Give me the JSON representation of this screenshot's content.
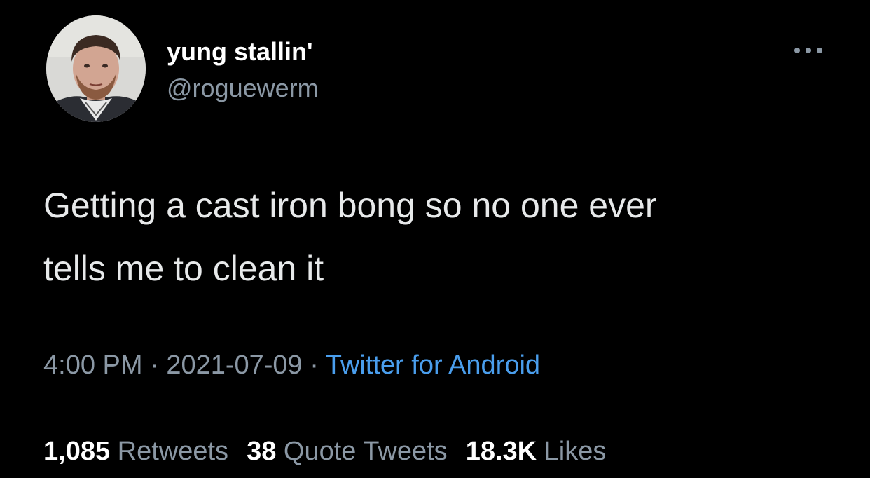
{
  "user": {
    "display_name": "yung stallin'",
    "handle": "@roguewerm"
  },
  "tweet": {
    "text": "Getting a cast iron bong so no one ever\ntells me to clean it",
    "time": "4:00 PM",
    "date": "2021-07-09",
    "separator": "·",
    "source": "Twitter for Android"
  },
  "stats": {
    "retweets": {
      "count": "1,085",
      "label": "Retweets"
    },
    "quotes": {
      "count": "38",
      "label": "Quote Tweets"
    },
    "likes": {
      "count": "18.3K",
      "label": "Likes"
    }
  },
  "icons": {
    "more": "more-horizontal-icon"
  },
  "colors": {
    "background": "#000000",
    "primary_text": "#e7e9ea",
    "secondary_text": "#8b98a5",
    "link": "#4a9eed",
    "divider": "#2f3336"
  }
}
